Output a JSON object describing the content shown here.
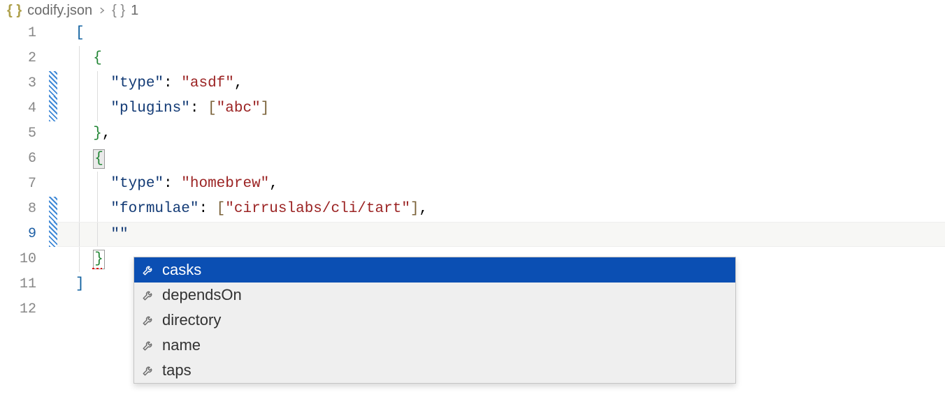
{
  "breadcrumb": {
    "file_icon": "{ }",
    "filename": "codify.json",
    "json_icon": "{ }",
    "path_segment": "1"
  },
  "editor": {
    "line_numbers": [
      "1",
      "2",
      "3",
      "4",
      "5",
      "6",
      "7",
      "8",
      "9",
      "10",
      "11",
      "12"
    ],
    "current_line": 9,
    "modified_lines": [
      3,
      4,
      8,
      9
    ],
    "code": {
      "l1": {
        "bracket": "["
      },
      "l2": {
        "brace": "{"
      },
      "l3": {
        "key": "\"type\"",
        "colon": ": ",
        "val": "\"asdf\"",
        "comma": ","
      },
      "l4": {
        "key": "\"plugins\"",
        "colon": ": ",
        "lb": "[",
        "val": "\"abc\"",
        "rb": "]"
      },
      "l5": {
        "brace": "}",
        "comma": ","
      },
      "l6": {
        "brace": "{"
      },
      "l7": {
        "key": "\"type\"",
        "colon": ": ",
        "val": "\"homebrew\"",
        "comma": ","
      },
      "l8": {
        "key": "\"formulae\"",
        "colon": ": ",
        "lb": "[",
        "val": "\"cirruslabs/cli/tart\"",
        "rb": "]",
        "comma": ","
      },
      "l9": {
        "val": "\"\""
      },
      "l10": {
        "brace": "}"
      },
      "l11": {
        "bracket": "]"
      },
      "l12": {
        "empty": ""
      }
    }
  },
  "suggestions": {
    "items": [
      {
        "label": "casks",
        "selected": true
      },
      {
        "label": "dependsOn",
        "selected": false
      },
      {
        "label": "directory",
        "selected": false
      },
      {
        "label": "name",
        "selected": false
      },
      {
        "label": "taps",
        "selected": false
      }
    ]
  }
}
